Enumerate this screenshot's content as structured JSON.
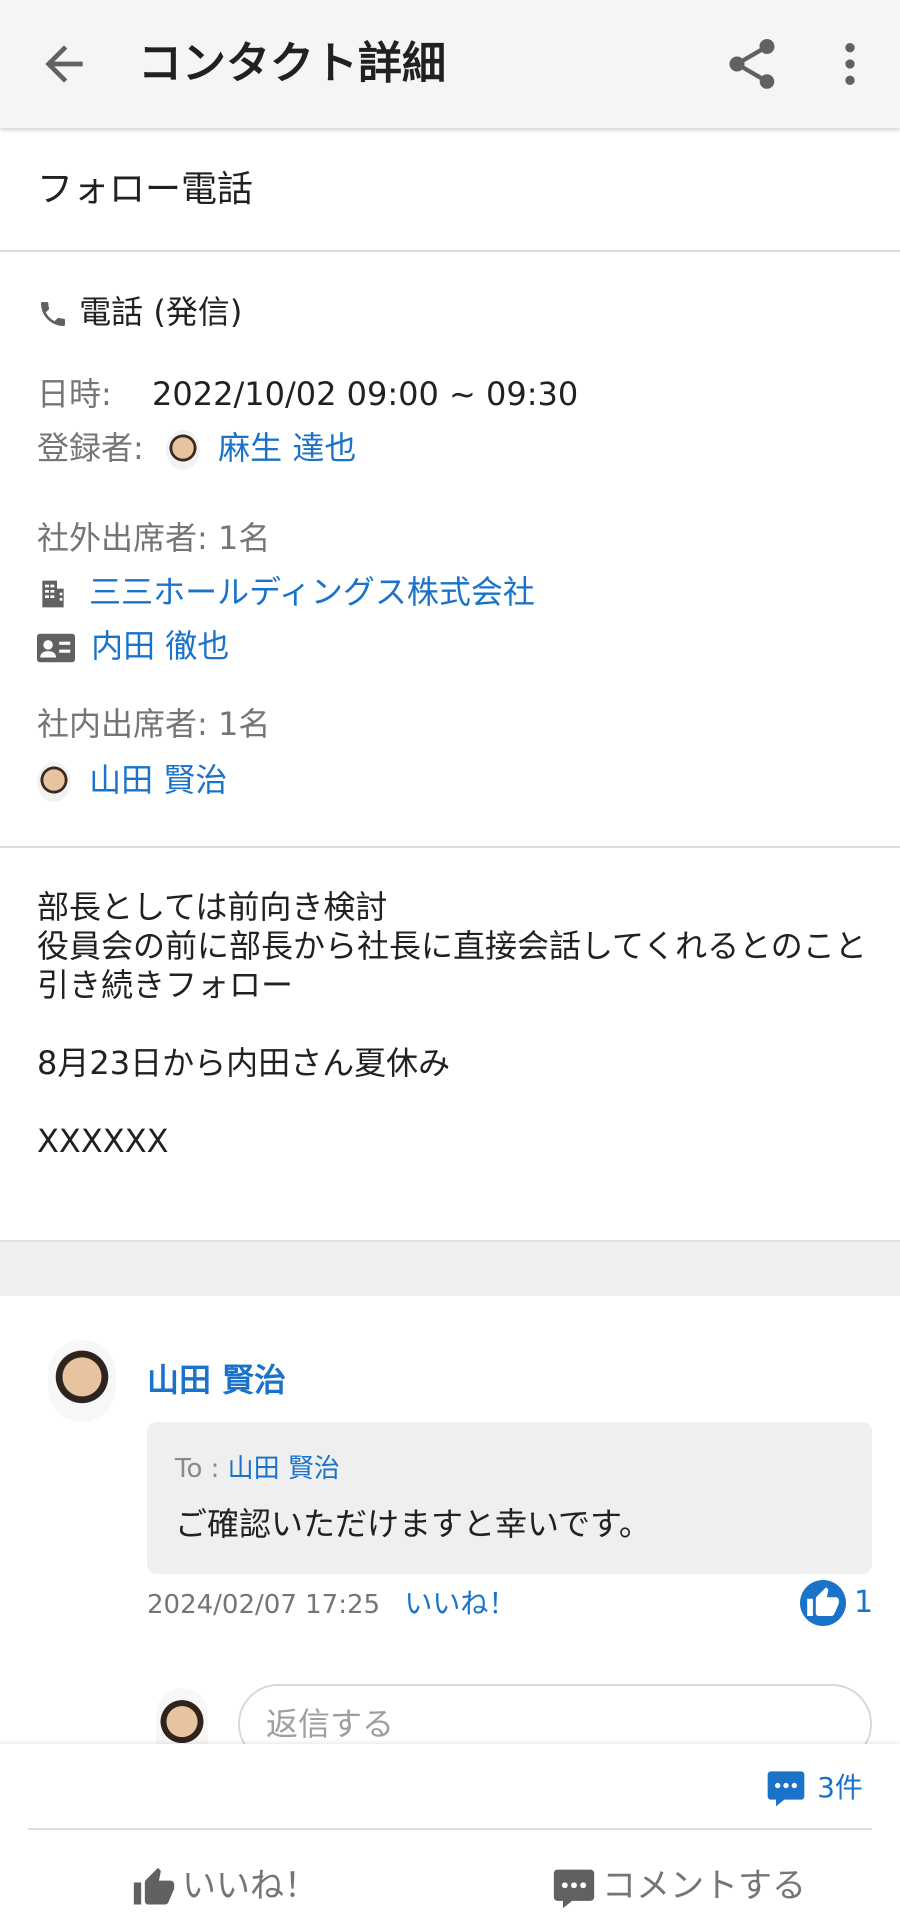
{
  "header": {
    "title": "コンタクト詳細"
  },
  "subject": "フォロー電話",
  "details": {
    "type_label": "電話 (発信)",
    "datetime_label": "日時:",
    "datetime_value": "2022/10/02 09:00 ~ 09:30",
    "registrant_label": "登録者:",
    "registrant_name": "麻生 達也",
    "external_label": "社外出席者: 1名",
    "external_company": "三三ホールディングス株式会社",
    "external_person": "内田 徹也",
    "internal_label": "社内出席者: 1名",
    "internal_person": "山田 賢治"
  },
  "memo": "部長としては前向き検討\n役員会の前に部長から社長に直接会話してくれるとのこと\n引き続きフォロー\n\n8月23日から内田さん夏休み\n\nXXXXXX",
  "comment": {
    "author": "山田 賢治",
    "to_prefix": "To :",
    "to_name": "山田 賢治",
    "message": "ご確認いただけますと幸いです。",
    "timestamp": "2024/02/07 17:25",
    "like_link": "いいね！",
    "like_count": "1"
  },
  "reply": {
    "placeholder": "返信する"
  },
  "bottom": {
    "comment_count": "3件",
    "like_label": "いいね！",
    "comment_label": "コメントする"
  },
  "colors": {
    "accent": "#1a73c8",
    "muted": "#757575",
    "appbar_bg": "#f5f5f5",
    "bubble_bg": "#efefef"
  }
}
